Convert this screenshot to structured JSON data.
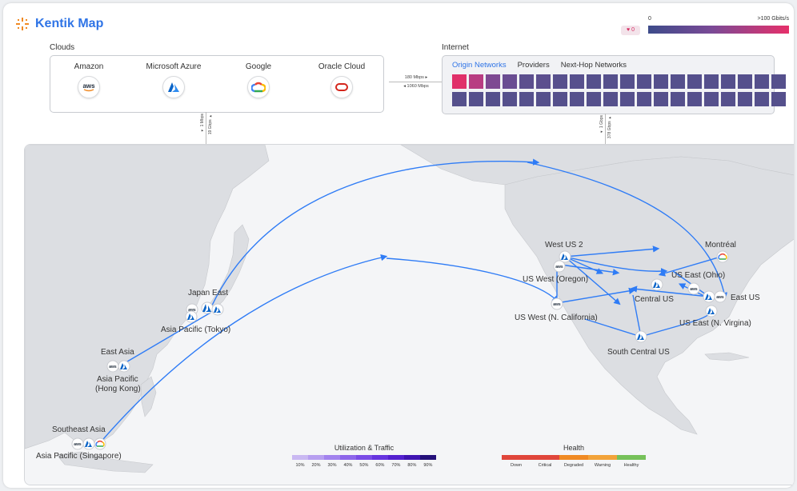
{
  "app": {
    "title": "Kentik Map",
    "logo_icon": "kentik-logo-icon",
    "brand_color": "#f08a24"
  },
  "scale": {
    "badge_value": "0",
    "min_label": "0",
    "max_label": ">100 Gbits/s"
  },
  "clouds": {
    "label": "Clouds",
    "providers": [
      {
        "name": "Amazon",
        "icon": "aws-icon"
      },
      {
        "name": "Microsoft Azure",
        "icon": "azure-icon"
      },
      {
        "name": "Google",
        "icon": "google-cloud-icon"
      },
      {
        "name": "Oracle Cloud",
        "icon": "oracle-cloud-icon"
      }
    ]
  },
  "links": {
    "clouds_to_internet_out": "180 Mbps ▸",
    "clouds_to_internet_in": "◂ 1060 Mbps",
    "clouds_to_map_a": "19 Gbps ▸",
    "clouds_to_map_b": "◂ 1 Mbps",
    "internet_to_map_a": "378 Gbps ▸",
    "internet_to_map_b": "◂ 1 Gbps"
  },
  "internet": {
    "label": "Internet",
    "tabs": [
      {
        "label": "Origin Networks",
        "active": true
      },
      {
        "label": "Providers",
        "active": false
      },
      {
        "label": "Next-Hop Networks",
        "active": false
      }
    ],
    "row1_colors": [
      "#e0306a",
      "#b83d82",
      "#7e4992",
      "#6a4d92",
      "#5c4f8e",
      "#5c4f8e",
      "#57508d",
      "#57508d",
      "#55508c",
      "#55508c",
      "#55508c",
      "#55508c",
      "#55508c",
      "#55508c",
      "#55508c",
      "#55508c",
      "#55508c",
      "#55508c",
      "#55508c",
      "#55508c"
    ],
    "row2_colors": [
      "#55508c",
      "#55508c",
      "#55508c",
      "#55508c",
      "#55508c",
      "#55508c",
      "#55508c",
      "#55508c",
      "#55508c",
      "#55508c",
      "#55508c",
      "#55508c",
      "#55508c",
      "#55508c",
      "#55508c",
      "#55508c",
      "#55508c",
      "#55508c",
      "#55508c",
      "#55508c"
    ]
  },
  "map": {
    "arc_color": "#2f7cf6",
    "regions": {
      "japan_east": "Japan East",
      "ap_tokyo": "Asia Pacific (Tokyo)",
      "east_asia": "East Asia",
      "ap_hk_1": "Asia Pacific",
      "ap_hk_2": "(Hong Kong)",
      "se_asia": "Southeast Asia",
      "ap_singapore": "Asia Pacific (Singapore)",
      "west_us_2": "West US 2",
      "us_west_oregon": "US West (Oregon)",
      "us_west_ncal": "US West (N. California)",
      "central_us": "Central US",
      "south_central_us": "South Central US",
      "montreal": "Montréal",
      "us_east_ohio": "US East (Ohio)",
      "east_us": "East US",
      "us_east_virginia": "US East (N. Virgina)"
    }
  },
  "legend": {
    "utilization": {
      "title": "Utilization & Traffic",
      "ticks": [
        "10%",
        "20%",
        "30%",
        "40%",
        "50%",
        "60%",
        "70%",
        "80%",
        "90%"
      ],
      "colors": [
        "#c9b8f2",
        "#b79ff0",
        "#a283ee",
        "#8d66ea",
        "#7a4ce6",
        "#6634df",
        "#5420cf",
        "#3f14b2",
        "#24107a"
      ]
    },
    "health": {
      "title": "Health",
      "ticks": [
        "Down",
        "Critical",
        "Degraded",
        "Warning",
        "Healthy"
      ],
      "colors": [
        "#e0463b",
        "#e0463b",
        "#f08a24",
        "#f2a33a",
        "#76c15a"
      ]
    }
  }
}
